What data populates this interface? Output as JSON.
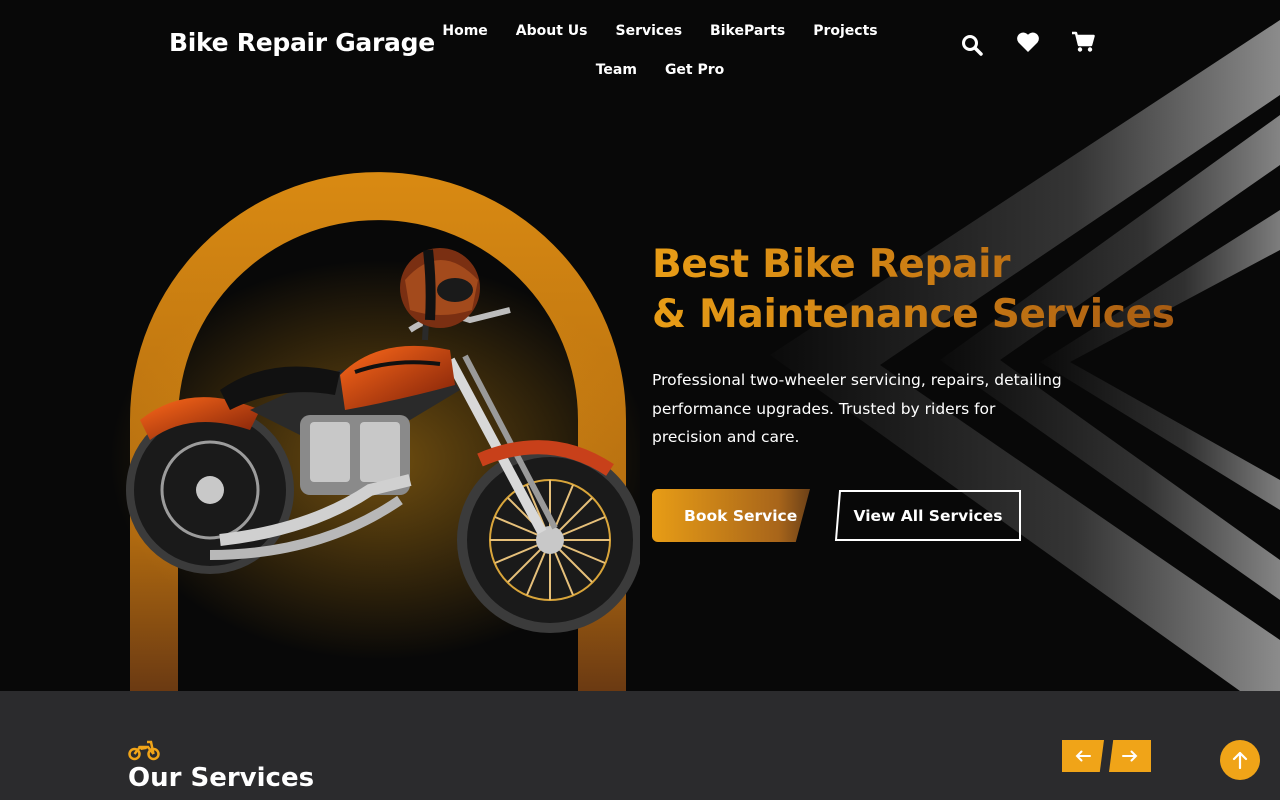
{
  "header": {
    "logo": "Bike Repair Garage",
    "nav": [
      "Home",
      "About Us",
      "Services",
      "BikeParts",
      "Projects",
      "Team",
      "Get Pro"
    ],
    "icons": [
      "search-icon",
      "heart-icon",
      "cart-icon"
    ]
  },
  "hero": {
    "headline_line1": "Best Bike Repair",
    "headline_line2": "& Maintenance Services",
    "description": "Professional two-wheeler servicing, repairs, detailing performance upgrades. Trusted by riders for precision and care.",
    "primary_button": "Book Service",
    "secondary_button": "View All Services",
    "image": "motorcycle-with-helmet"
  },
  "services": {
    "title": "Our Services",
    "icon": "motorcycle-icon",
    "prev_icon": "arrow-left-icon",
    "next_icon": "arrow-right-icon"
  },
  "back_to_top_icon": "arrow-up-icon",
  "colors": {
    "accent": "#f0a418",
    "accent_dark": "#a85c12",
    "background": "#080808",
    "section_background": "#2b2b2d",
    "text": "#ffffff"
  }
}
